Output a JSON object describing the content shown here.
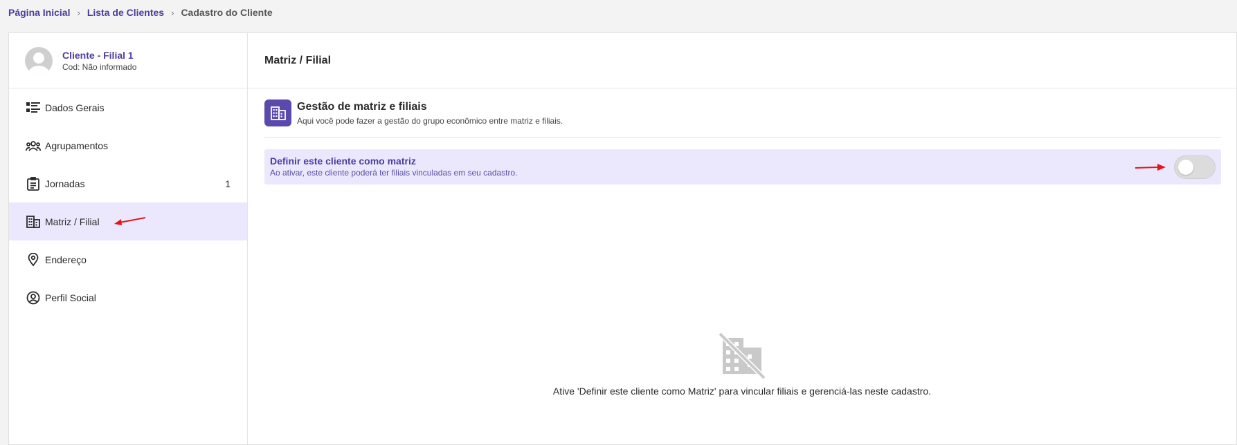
{
  "breadcrumb": {
    "items": [
      "Página Inicial",
      "Lista de Clientes"
    ],
    "current": "Cadastro do Cliente",
    "separator": "›"
  },
  "client": {
    "name": "Cliente - Filial 1",
    "code": "Cod: Não informado"
  },
  "sidebar": {
    "items": [
      {
        "label": "Dados Gerais",
        "icon": "list-details-icon"
      },
      {
        "label": "Agrupamentos",
        "icon": "group-icon"
      },
      {
        "label": "Jornadas",
        "icon": "clipboard-icon",
        "count": "1"
      },
      {
        "label": "Matriz / Filial",
        "icon": "building-icon",
        "active": true
      },
      {
        "label": "Endereço",
        "icon": "location-pin-icon"
      },
      {
        "label": "Perfil Social",
        "icon": "account-circle-icon"
      }
    ]
  },
  "main": {
    "header_title": "Matriz / Filial",
    "section": {
      "title": "Gestão de matriz e filiais",
      "subtitle": "Aqui você pode fazer a gestão do grupo econômico entre matriz e filiais."
    },
    "matriz_toggle": {
      "title": "Definir este cliente como matriz",
      "subtitle": "Ao ativar, este cliente poderá ter filiais vinculadas em seu cadastro.",
      "enabled": false
    },
    "empty_state": {
      "icon": "building-off-icon",
      "text": "Ative 'Definir este cliente como Matriz' para vincular filiais e gerenciá-las neste cadastro."
    }
  },
  "colors": {
    "accent": "#4b3e9e",
    "active_bg": "#ebe8fd",
    "annotation_arrow": "#e8141c"
  }
}
